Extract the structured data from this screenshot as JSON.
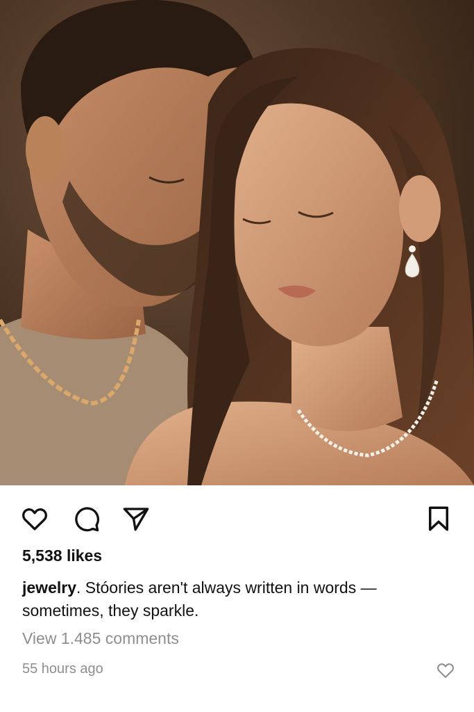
{
  "post": {
    "image_alt": "Couple embracing with eyes closed, man wearing gold chain necklace, woman wearing diamond tennis necklace and drop earrings",
    "likes_text": "5,538 likes",
    "username": "jewelry",
    "caption_text": ". Stóories aren't always written in words — sometimes, they sparkle.",
    "view_comments_text": "View 1.485 comments",
    "timestamp": "55 hours ago"
  },
  "actions": {
    "like_icon": "heart-icon",
    "comment_icon": "comment-bubble-icon",
    "share_icon": "paper-plane-icon",
    "save_icon": "bookmark-icon"
  },
  "colors": {
    "text_primary": "#111111",
    "text_secondary": "#8e8e8e",
    "background": "#ffffff"
  }
}
